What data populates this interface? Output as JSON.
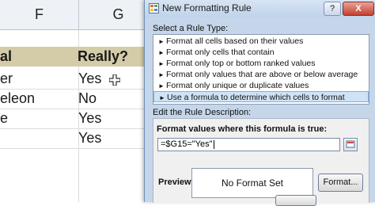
{
  "sheet": {
    "columns": [
      "F",
      "G"
    ],
    "header_row": [
      "al",
      "Really?"
    ],
    "rows": [
      [
        "er",
        "Yes"
      ],
      [
        "eleon",
        "No"
      ],
      [
        "e",
        "Yes"
      ],
      [
        "",
        "Yes"
      ]
    ]
  },
  "dialog": {
    "title": "New Formatting Rule",
    "help_label": "?",
    "close_label": "X",
    "select_rule_type_label": "Select a Rule Type:",
    "rule_types": [
      "Format all cells based on their values",
      "Format only cells that contain",
      "Format only top or bottom ranked values",
      "Format only values that are above or below average",
      "Format only unique or duplicate values",
      "Use a formula to determine which cells to format"
    ],
    "selected_rule_index": 5,
    "edit_description_label": "Edit the Rule Description:",
    "formula_label": "Format values where this formula is true:",
    "formula_value": "=$G15=\"Yes\"",
    "preview_label": "Preview:",
    "preview_text": "No Format Set",
    "format_button": "Format..."
  },
  "icons": {
    "title_icon": "conditional-format-icon",
    "rule_arrow": "triangle-right-icon",
    "collapse": "collapse-dialog-icon",
    "cursor": "cell-select-cursor-icon"
  }
}
